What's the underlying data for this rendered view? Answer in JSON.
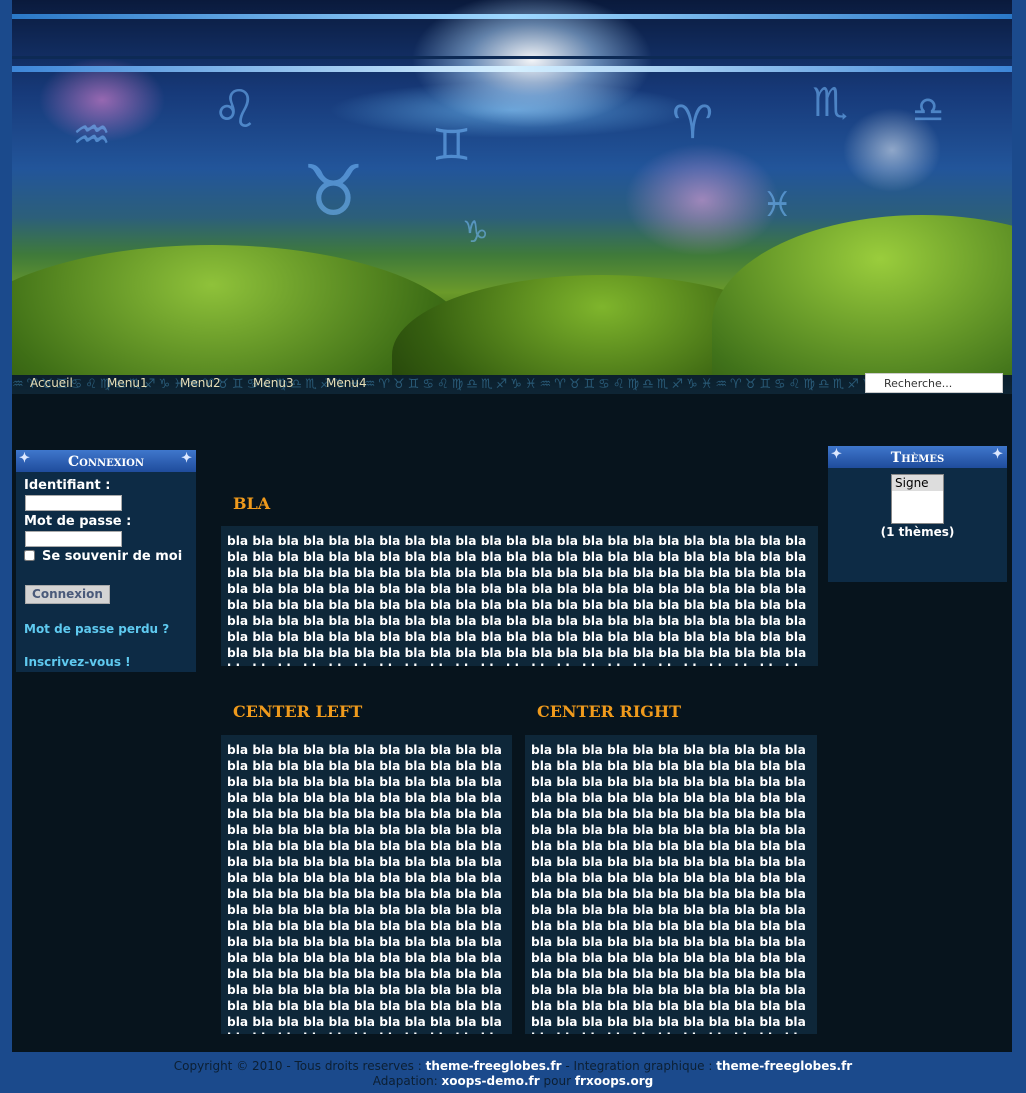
{
  "nav": {
    "items": [
      "Accueil",
      "Menu1",
      "Menu2",
      "Menu3",
      "Menu4"
    ],
    "search_placeholder": "Recherche..."
  },
  "login_block": {
    "title": "Connexion",
    "username_label": "Identifiant :",
    "password_label": "Mot de passe :",
    "remember_label": "Se souvenir de moi",
    "submit_label": "Connexion",
    "lost_password": "Mot de passe perdu ?",
    "register": "Inscrivez-vous !"
  },
  "themes_block": {
    "title": "Thèmes",
    "options": [
      "Signe"
    ],
    "count_label": "(1 thèmes)"
  },
  "main": {
    "top": {
      "title": "BLA",
      "body": "bla bla bla bla bla bla bla bla bla bla bla bla bla bla bla bla bla bla bla bla bla bla bla bla bla bla bla bla bla bla bla bla bla bla bla bla bla bla bla bla bla bla bla bla bla bla bla bla bla bla bla bla bla bla bla bla bla bla bla bla bla bla bla bla bla bla bla bla bla bla bla bla bla bla bla bla bla bla bla bla bla bla bla bla bla bla bla bla bla bla bla bla bla bla bla bla bla bla bla bla bla bla bla bla bla bla bla bla bla bla bla bla bla bla bla bla bla bla bla bla bla bla bla bla bla bla bla bla bla bla bla bla bla bla bla bla bla bla bla bla bla bla bla bla bla bla bla bla bla bla bla bla bla bla bla bla bla bla bla bla bla bla bla bla bla bla bla bla bla bla bla bla bla bla bla bla bla bla bla bla bla bla bla bla bla bla bla bla bla bla bla bla bla bla bla bla bla bla bla bla bla bla bla bla bla bla bla bla bla bla bla bla bla bla bla bla bla bla bla bla bla bla bla bla bla bla bla bla bla bla bla bla bla"
    },
    "center_left": {
      "title": "CENTER LEFT",
      "body": "bla bla bla bla bla bla bla bla bla bla bla bla bla bla bla bla bla bla bla bla bla bla bla bla bla bla bla bla bla bla bla bla bla bla bla bla bla bla bla bla bla bla bla bla bla bla bla bla bla bla bla bla bla bla bla bla bla bla bla bla bla bla bla bla bla bla bla bla bla bla bla bla bla bla bla bla bla bla bla bla bla bla bla bla bla bla bla bla bla bla bla bla bla bla bla bla bla bla bla bla bla bla bla bla bla bla bla bla bla bla bla bla bla bla bla bla bla bla bla bla bla bla bla bla bla bla bla bla bla bla bla bla bla bla bla bla bla bla bla bla bla bla bla bla bla bla bla bla bla bla bla bla bla bla bla bla bla bla bla bla bla bla bla bla bla bla bla bla bla bla bla bla bla bla bla bla bla bla bla bla bla bla bla bla bla bla bla bla bla bla bla bla bla bla bla bla bla bla bla bla bla bla bla bla bla bla bla bla bla bla bla bla"
    },
    "center_right": {
      "title": "CENTER RIGHT",
      "body": "bla bla bla bla bla bla bla bla bla bla bla bla bla bla bla bla bla bla bla bla bla bla bla bla bla bla bla bla bla bla bla bla bla bla bla bla bla bla bla bla bla bla bla bla bla bla bla bla bla bla bla bla bla bla bla bla bla bla bla bla bla bla bla bla bla bla bla bla bla bla bla bla bla bla bla bla bla bla bla bla bla bla bla bla bla bla bla bla bla bla bla bla bla bla bla bla bla bla bla bla bla bla bla bla bla bla bla bla bla bla bla bla bla bla bla bla bla bla bla bla bla bla bla bla bla bla bla bla bla bla bla bla bla bla bla bla bla bla bla bla bla bla bla bla bla bla bla bla bla bla bla bla bla bla bla bla bla bla bla bla bla bla bla bla bla bla bla bla bla bla bla bla bla bla bla bla bla bla bla bla bla bla bla bla bla bla bla bla bla bla bla bla bla bla bla bla bla bla bla bla bla bla bla bla bla bla bla bla bla bla"
    }
  },
  "footer": {
    "line1_prefix": "Copyright © 2010 - Tous droits reserves :",
    "line1_link1": "theme-freeglobes.fr",
    "line1_mid": "- Integration graphique :",
    "line1_link2": "theme-freeglobes.fr",
    "line2_prefix": "Adapation:",
    "line2_link1": "xoops-demo.fr",
    "line2_mid": "pour",
    "line2_link2": "frxoops.org"
  },
  "colors": {
    "body_bg": "#1b4a8c",
    "page_bg": "#07141d",
    "block_bg": "#0d2b45",
    "heading_orange": "#ef9a1c",
    "link_cyan": "#5fcaf0"
  }
}
